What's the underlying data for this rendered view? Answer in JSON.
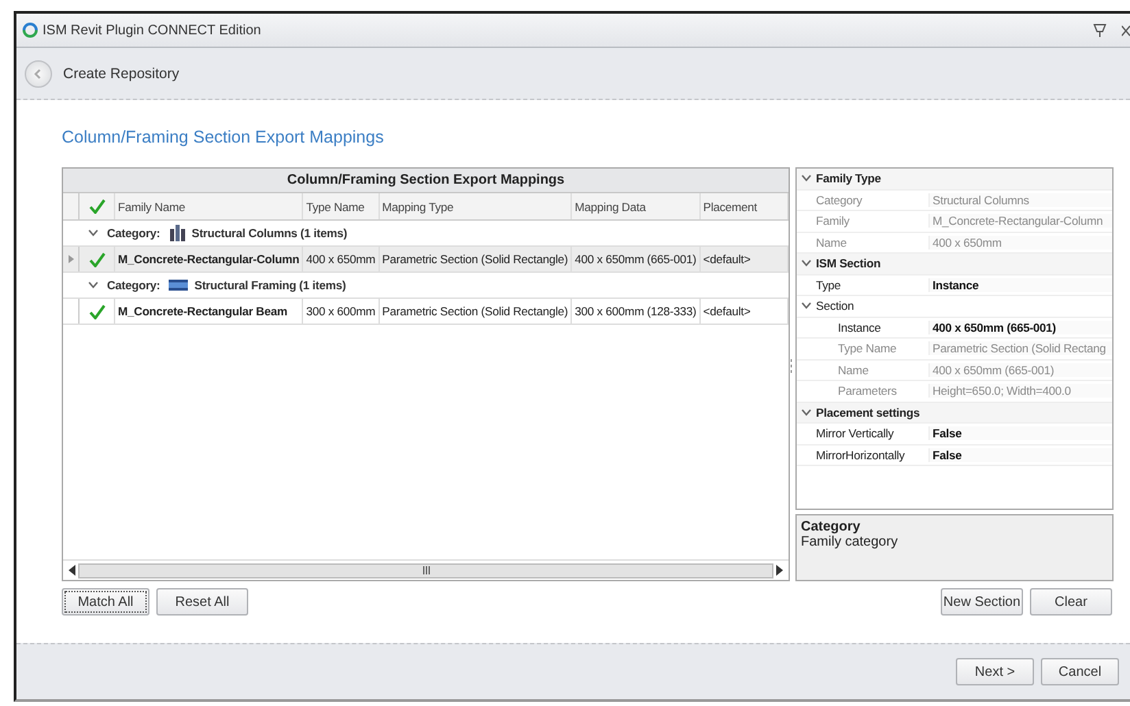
{
  "window": {
    "title": "ISM Revit Plugin CONNECT Edition"
  },
  "nav": {
    "title": "Create Repository"
  },
  "heading": "Column/Framing Section Export Mappings",
  "grid": {
    "caption": "Column/Framing Section Export Mappings",
    "columns": [
      "Family Name",
      "Type Name",
      "Mapping Type",
      "Mapping Data",
      "Placement"
    ],
    "groups": [
      {
        "label": "Category:",
        "name": "Structural Columns (1 items)",
        "kind": "columns",
        "expanded": true,
        "rows": [
          {
            "checked": true,
            "selected": true,
            "cells": [
              "M_Concrete-Rectangular-Column",
              "400 x 650mm",
              "Parametric Section (Solid Rectangle)",
              "400 x 650mm (665-001)",
              "<default>"
            ]
          }
        ]
      },
      {
        "label": "Category:",
        "name": "Structural Framing (1 items)",
        "kind": "framing",
        "expanded": true,
        "rows": [
          {
            "checked": true,
            "selected": false,
            "cells": [
              "M_Concrete-Rectangular Beam",
              "300 x 600mm",
              "Parametric Section (Solid Rectangle)",
              "300 x 600mm (128-333)",
              "<default>"
            ]
          }
        ]
      }
    ]
  },
  "properties": [
    {
      "title": "Family Type",
      "expanded": true,
      "rows": [
        {
          "label": "Category",
          "value": "Structural Columns",
          "readonly": true,
          "emphasized": false
        },
        {
          "label": "Family",
          "value": "M_Concrete-Rectangular-Column",
          "readonly": true,
          "emphasized": false
        },
        {
          "label": "Name",
          "value": "400 x 650mm",
          "readonly": true,
          "emphasized": false
        }
      ]
    },
    {
      "title": "ISM Section",
      "expanded": true,
      "rows": [
        {
          "label": "Type",
          "value": "Instance",
          "readonly": false,
          "emphasized": true
        },
        {
          "label": "Section",
          "readonly": false,
          "expanded": true,
          "children": [
            {
              "label": "Instance",
              "value": "400 x 650mm (665-001)",
              "readonly": false,
              "emphasized": true
            },
            {
              "label": "Type Name",
              "value": "Parametric Section (Solid Rectang",
              "readonly": true,
              "emphasized": false
            },
            {
              "label": "Name",
              "value": "400 x 650mm (665-001)",
              "readonly": true,
              "emphasized": false
            },
            {
              "label": "Parameters",
              "value": "Height=650.0; Width=400.0",
              "readonly": true,
              "emphasized": false
            }
          ]
        }
      ]
    },
    {
      "title": "Placement settings",
      "expanded": true,
      "rows": [
        {
          "label": "Mirror Vertically",
          "value": "False",
          "readonly": false,
          "emphasized": true
        },
        {
          "label": "MirrorHorizontally",
          "value": "False",
          "readonly": false,
          "emphasized": true
        }
      ]
    }
  ],
  "description": {
    "title": "Category",
    "text": "Family category"
  },
  "grid_buttons": [
    "Match All",
    "Reset All"
  ],
  "property_buttons": [
    "New Section",
    "Clear"
  ],
  "footer_buttons": [
    "Next >",
    "Cancel"
  ]
}
